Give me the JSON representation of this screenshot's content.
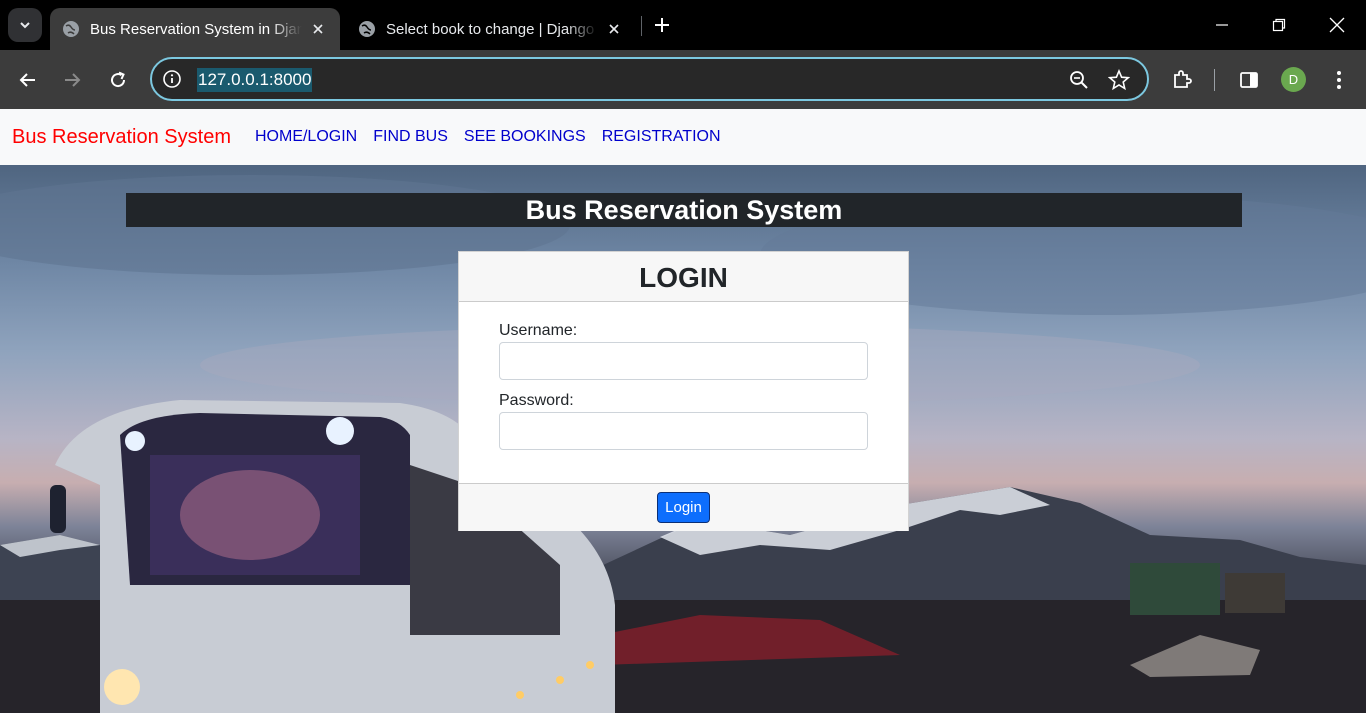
{
  "browser": {
    "tabs": [
      {
        "title": "Bus Reservation System in Djang",
        "active": true
      },
      {
        "title": "Select book to change | Django",
        "active": false
      }
    ],
    "address": "127.0.0.1:8000",
    "profile_initial": "D"
  },
  "navbar": {
    "brand": "Bus Reservation System",
    "links": [
      "HOME/LOGIN",
      "FIND BUS",
      "SEE BOOKINGS",
      "REGISTRATION"
    ]
  },
  "main": {
    "banner_title": "Bus Reservation System",
    "login_card": {
      "title": "LOGIN",
      "username_label": "Username:",
      "username_value": "",
      "password_label": "Password:",
      "password_value": "",
      "submit_label": "Login"
    }
  },
  "colors": {
    "brand": "#ff0000",
    "nav_link": "#0000cc",
    "banner_bg": "#212529",
    "primary_button": "#0d6efd",
    "omnibox_focus": "#7cc8e0"
  }
}
